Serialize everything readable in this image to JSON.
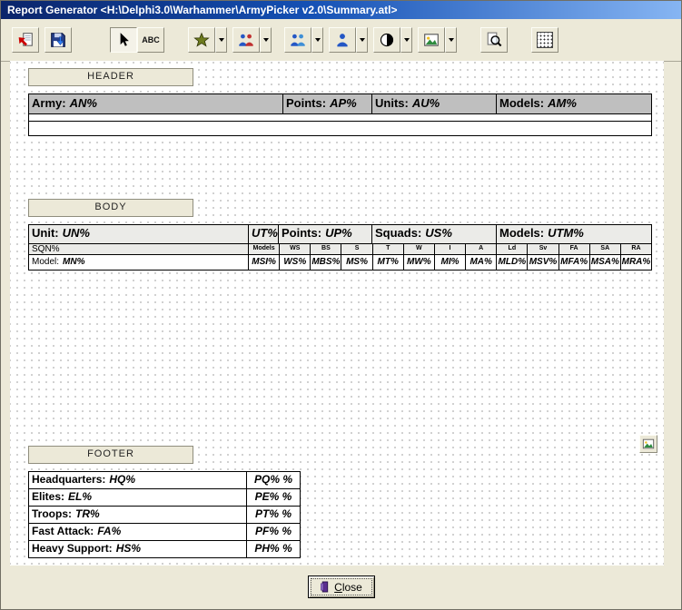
{
  "window": {
    "title": "Report Generator <H:\\Delphi3.0\\Warhammer\\ArmyPicker v2.0\\Summary.atl>"
  },
  "toolbar": {
    "abc_label": "ABC",
    "buttons": [
      {
        "icon": "open-report-icon"
      },
      {
        "icon": "save-report-icon"
      },
      {
        "icon": "cursor-icon",
        "pressed": true
      },
      {
        "icon": "abc-text-icon"
      },
      {
        "icon": "star-icon",
        "dropdown": true
      },
      {
        "icon": "people-group-icon",
        "dropdown": true
      },
      {
        "icon": "people-pair-icon",
        "dropdown": true
      },
      {
        "icon": "person-icon",
        "dropdown": true
      },
      {
        "icon": "contrast-circle-icon",
        "dropdown": true
      },
      {
        "icon": "picture-icon",
        "dropdown": true
      },
      {
        "icon": "preview-magnifier-icon"
      },
      {
        "icon": "grid-icon"
      }
    ]
  },
  "bands": {
    "header": {
      "tab_label": "HEADER",
      "cells": [
        {
          "label": "Army:",
          "value": "AN%"
        },
        {
          "label": "Points:",
          "value": "AP%"
        },
        {
          "label": "Units:",
          "value": "AU%"
        },
        {
          "label": "Models:",
          "value": "AM%"
        }
      ]
    },
    "body": {
      "tab_label": "BODY",
      "title_cells": [
        {
          "label": "Unit:",
          "value": "UN%"
        },
        {
          "label": "",
          "value": "UT%"
        },
        {
          "label": "Points:",
          "value": "UP%"
        },
        {
          "label": "Squads:",
          "value": "US%"
        },
        {
          "label": "Models:",
          "value": "UTM%"
        }
      ],
      "squad_label": "SQN%",
      "model_label": "Model:",
      "model_value": "MN%",
      "stat_headers": [
        "Models",
        "WS",
        "BS",
        "S",
        "T",
        "W",
        "I",
        "A",
        "Ld",
        "Sv",
        "FA",
        "SA",
        "RA"
      ],
      "stat_values": [
        "MSI%",
        "WS%",
        "MBS%",
        "MS%",
        "MT%",
        "MW%",
        "MI%",
        "MA%",
        "MLD%",
        "MSV%",
        "MFA%",
        "MSA%",
        "MRA%"
      ]
    },
    "footer": {
      "tab_label": "FOOTER",
      "rows": [
        {
          "label": "Headquarters:",
          "tag": "HQ%",
          "value": "PQ% %"
        },
        {
          "label": "Elites:",
          "tag": "EL%",
          "value": "PE% %"
        },
        {
          "label": "Troops:",
          "tag": "TR%",
          "value": "PT% %"
        },
        {
          "label": "Fast Attack:",
          "tag": "FA%",
          "value": "PF% %"
        },
        {
          "label": "Heavy Support:",
          "tag": "HS%",
          "value": "PH% %"
        }
      ]
    }
  },
  "close_button": {
    "accel": "C",
    "rest": "lose"
  },
  "colors": {
    "titlebar_start": "#0a246a",
    "titlebar_end": "#86b5f3",
    "chrome": "#ECE9D8",
    "band_header_bg": "#bfbfbf"
  }
}
